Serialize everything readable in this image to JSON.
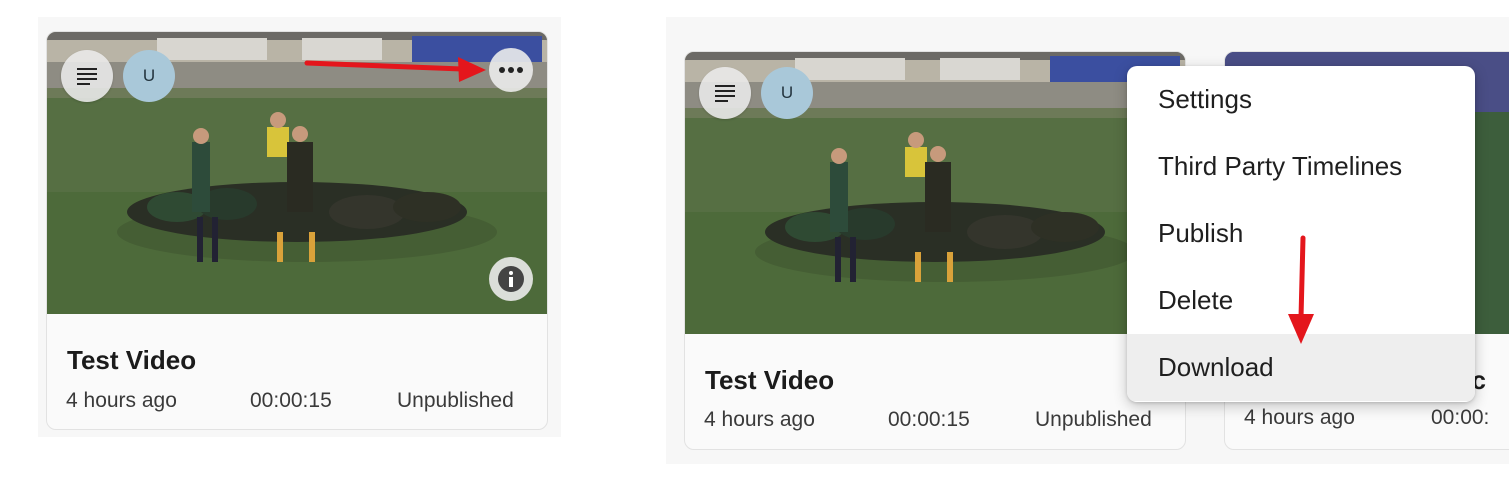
{
  "colors": {
    "annotation_arrow": "#e4161c",
    "avatar_bg": "#a9c8d9",
    "grass": "#4f6a3c",
    "card_bg": "#fafafa",
    "menu_hover": "#eeeeee"
  },
  "cards": [
    {
      "title": "Test Video",
      "age": "4 hours ago",
      "duration": "00:00:15",
      "status": "Unpublished",
      "avatar_initial": "U",
      "icons": [
        "list-icon",
        "more-horizontal-icon",
        "info-icon"
      ]
    },
    {
      "title": "Test Video",
      "age": "4 hours ago",
      "duration": "00:00:15",
      "status": "Unpublished",
      "avatar_initial": "U",
      "icons": [
        "list-icon"
      ]
    },
    {
      "title_fragment": "ec",
      "age": "4 hours ago",
      "duration": "00:00:"
    }
  ],
  "menu": {
    "items": [
      "Settings",
      "Third Party Timelines",
      "Publish",
      "Delete",
      "Download"
    ],
    "highlighted": "Download"
  }
}
